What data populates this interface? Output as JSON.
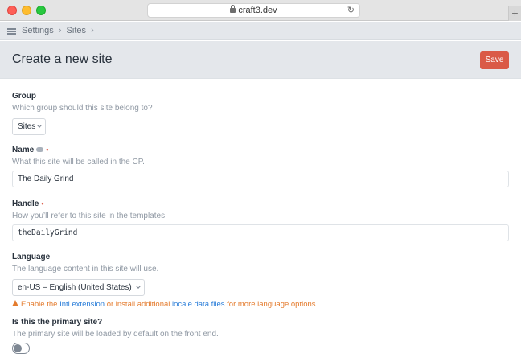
{
  "browser": {
    "url": "craft3.dev"
  },
  "breadcrumb": {
    "items": [
      "Settings",
      "Sites"
    ],
    "separator": "›"
  },
  "header": {
    "title": "Create a new site",
    "save_label": "Save"
  },
  "form": {
    "group": {
      "label": "Group",
      "instructions": "Which group should this site belong to?",
      "value": "Sites"
    },
    "name": {
      "label": "Name",
      "instructions": "What this site will be called in the CP.",
      "value": "The Daily Grind",
      "required_mark": "•"
    },
    "handle": {
      "label": "Handle",
      "instructions": "How you’ll refer to this site in the templates.",
      "value": "theDailyGrind",
      "required_mark": "•"
    },
    "language": {
      "label": "Language",
      "instructions": "The language content in this site will use.",
      "value": "en-US – English (United States)",
      "warning": {
        "prefix": "Enable the",
        "link1": "Intl extension",
        "middle": "or install additional",
        "link2": "locale data files",
        "suffix": "for more language options."
      }
    },
    "primary": {
      "label": "Is this the primary site?",
      "instructions": "The primary site will be loaded by default on the front end.",
      "enabled": false
    }
  },
  "colors": {
    "accent": "#da5a47",
    "link": "#2b7ed9",
    "warning": "#e47b2d"
  }
}
